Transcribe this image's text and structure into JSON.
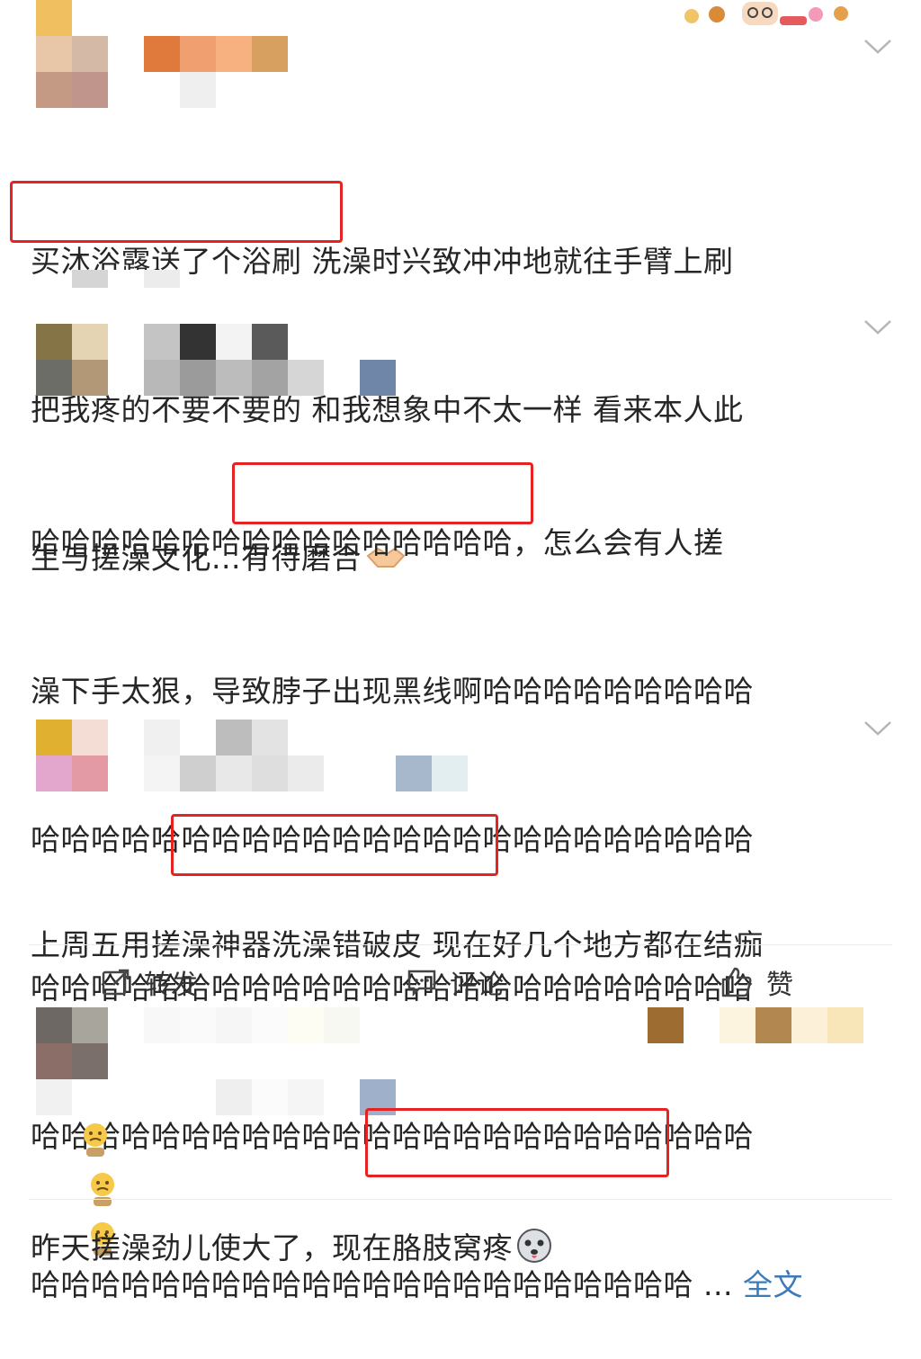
{
  "posts": [
    {
      "text": "买沐浴露送了个浴刷 洗澡时兴致冲冲地就往手臂上刷把我疼的不要不要的 和我想象中不太一样 看来本人此生与搓澡文化...有待磨合",
      "line1": "买沐浴露送了个浴刷 洗澡时兴致冲冲地就往手臂上刷",
      "line2": "把我疼的不要不要的 和我想象中不太一样 看来本人此",
      "line3": "生与搓澡文化...有待磨合",
      "highlight": "把我疼的不要不要的",
      "trailing_emoji": "handshake-emoji"
    },
    {
      "line1": "哈哈哈哈哈哈哈哈哈哈哈哈哈哈哈哈，怎么会有人搓",
      "line2": "澡下手太狠，导致脖子出现黑线啊哈哈哈哈哈哈哈哈哈",
      "line3": "哈哈哈哈哈哈哈哈哈哈哈哈哈哈哈哈哈哈哈哈哈哈哈哈",
      "line4": "哈哈哈哈哈哈哈哈哈哈哈哈哈哈哈哈哈哈哈哈哈哈哈哈",
      "line5": "哈哈哈哈哈哈哈哈哈哈哈哈哈哈哈哈哈哈哈哈哈哈哈哈",
      "line6": "哈哈哈哈哈哈哈哈哈哈哈哈哈哈哈哈哈哈哈哈哈哈 ...",
      "more_label": "全文",
      "highlight": "导致脖子出现黑线"
    },
    {
      "line1": "上周五用搓澡神器洗澡错破皮 现在好几个地方都在结痂",
      "highlight": "搓澡神器洗澡错破皮",
      "trailing_emoji": "sad-emoji"
    },
    {
      "line1": "昨天搓澡劲儿使大了，现在胳肢窝疼",
      "highlight": "现在胳肢窝疼",
      "trailing_emoji": "husky-emoji"
    }
  ],
  "actions": {
    "repost": "转发",
    "comment": "评论",
    "like": "赞"
  },
  "colors": {
    "highlight_box": "#e52323",
    "link": "#3c7ab8",
    "text": "#262626"
  }
}
